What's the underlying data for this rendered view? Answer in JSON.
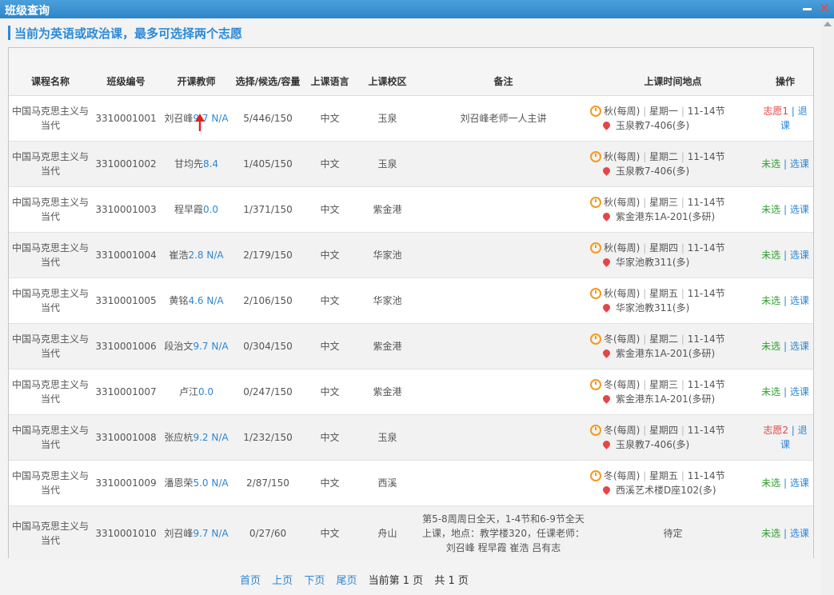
{
  "window": {
    "title": "班级查询",
    "minimize_icon": "minimize-icon",
    "close_icon": "close-icon"
  },
  "notice": "当前为英语或政治课，最多可选择两个志愿",
  "table": {
    "headers": [
      "课程名称",
      "班级编号",
      "开课教师",
      "选择/候选/容量",
      "上课语言",
      "上课校区",
      "备注",
      "上课时间地点",
      "操作"
    ],
    "rows": [
      {
        "course": "中国马克思主义与当代",
        "class_no": "3310001001",
        "teacher": "刘召峰",
        "score": "9.7 N/A",
        "count": "5/446/150",
        "lang": "中文",
        "campus": "玉泉",
        "note": "刘召峰老师一人主讲",
        "schedule": {
          "term": "秋(每周)",
          "day": "星期一",
          "periods": "11-14节",
          "room": "玉泉教7-406(多)"
        },
        "status": "志愿1",
        "status_type": "pref",
        "action": "退课"
      },
      {
        "course": "中国马克思主义与当代",
        "class_no": "3310001002",
        "teacher": "甘均先",
        "score": "8.4",
        "count": "1/405/150",
        "lang": "中文",
        "campus": "玉泉",
        "note": "",
        "schedule": {
          "term": "秋(每周)",
          "day": "星期二",
          "periods": "11-14节",
          "room": "玉泉教7-406(多)"
        },
        "status": "未选",
        "status_type": "none",
        "action": "选课"
      },
      {
        "course": "中国马克思主义与当代",
        "class_no": "3310001003",
        "teacher": "程早霞",
        "score": "0.0",
        "count": "1/371/150",
        "lang": "中文",
        "campus": "紫金港",
        "note": "",
        "schedule": {
          "term": "秋(每周)",
          "day": "星期三",
          "periods": "11-14节",
          "room": "紫金港东1A-201(多研)"
        },
        "status": "未选",
        "status_type": "none",
        "action": "选课"
      },
      {
        "course": "中国马克思主义与当代",
        "class_no": "3310001004",
        "teacher": "崔浩",
        "score": "2.8 N/A",
        "count": "2/179/150",
        "lang": "中文",
        "campus": "华家池",
        "note": "",
        "schedule": {
          "term": "秋(每周)",
          "day": "星期四",
          "periods": "11-14节",
          "room": "华家池教311(多)"
        },
        "status": "未选",
        "status_type": "none",
        "action": "选课"
      },
      {
        "course": "中国马克思主义与当代",
        "class_no": "3310001005",
        "teacher": "黄铭",
        "score": "4.6 N/A",
        "count": "2/106/150",
        "lang": "中文",
        "campus": "华家池",
        "note": "",
        "schedule": {
          "term": "秋(每周)",
          "day": "星期五",
          "periods": "11-14节",
          "room": "华家池教311(多)"
        },
        "status": "未选",
        "status_type": "none",
        "action": "选课"
      },
      {
        "course": "中国马克思主义与当代",
        "class_no": "3310001006",
        "teacher": "段治文",
        "score": "9.7 N/A",
        "count": "0/304/150",
        "lang": "中文",
        "campus": "紫金港",
        "note": "",
        "schedule": {
          "term": "冬(每周)",
          "day": "星期二",
          "periods": "11-14节",
          "room": "紫金港东1A-201(多研)"
        },
        "status": "未选",
        "status_type": "none",
        "action": "选课"
      },
      {
        "course": "中国马克思主义与当代",
        "class_no": "3310001007",
        "teacher": "卢江",
        "score": "0.0",
        "count": "0/247/150",
        "lang": "中文",
        "campus": "紫金港",
        "note": "",
        "schedule": {
          "term": "冬(每周)",
          "day": "星期三",
          "periods": "11-14节",
          "room": "紫金港东1A-201(多研)"
        },
        "status": "未选",
        "status_type": "none",
        "action": "选课"
      },
      {
        "course": "中国马克思主义与当代",
        "class_no": "3310001008",
        "teacher": "张应杭",
        "score": "9.2 N/A",
        "count": "1/232/150",
        "lang": "中文",
        "campus": "玉泉",
        "note": "",
        "schedule": {
          "term": "冬(每周)",
          "day": "星期四",
          "periods": "11-14节",
          "room": "玉泉教7-406(多)"
        },
        "status": "志愿2",
        "status_type": "pref",
        "action": "退课"
      },
      {
        "course": "中国马克思主义与当代",
        "class_no": "3310001009",
        "teacher": "潘恩荣",
        "score": "5.0 N/A",
        "count": "2/87/150",
        "lang": "中文",
        "campus": "西溪",
        "note": "",
        "schedule": {
          "term": "冬(每周)",
          "day": "星期五",
          "periods": "11-14节",
          "room": "西溪艺术楼D座102(多)"
        },
        "status": "未选",
        "status_type": "none",
        "action": "选课"
      },
      {
        "course": "中国马克思主义与当代",
        "class_no": "3310001010",
        "teacher": "刘召峰",
        "score": "9.7 N/A",
        "count": "0/27/60",
        "lang": "中文",
        "campus": "舟山",
        "note": "第5-8周周日全天，1-4节和6-9节全天上课，地点：教学楼320，任课老师：刘召峰 程早霞 崔浩 吕有志",
        "schedule_text": "待定",
        "status": "未选",
        "status_type": "none",
        "action": "选课"
      }
    ]
  },
  "pager": {
    "first": "首页",
    "prev": "上页",
    "next": "下页",
    "last": "尾页",
    "current": "当前第 1 页",
    "total": "共 1 页"
  },
  "colors": {
    "titlebar": "#3b93d4",
    "accent": "#2a8ad8",
    "link": "#2d86d2",
    "pref": "#e04545",
    "unselected": "#2e9f2e",
    "clock": "#f39a1e",
    "pin": "#e64545",
    "arrow": "#e02020"
  }
}
